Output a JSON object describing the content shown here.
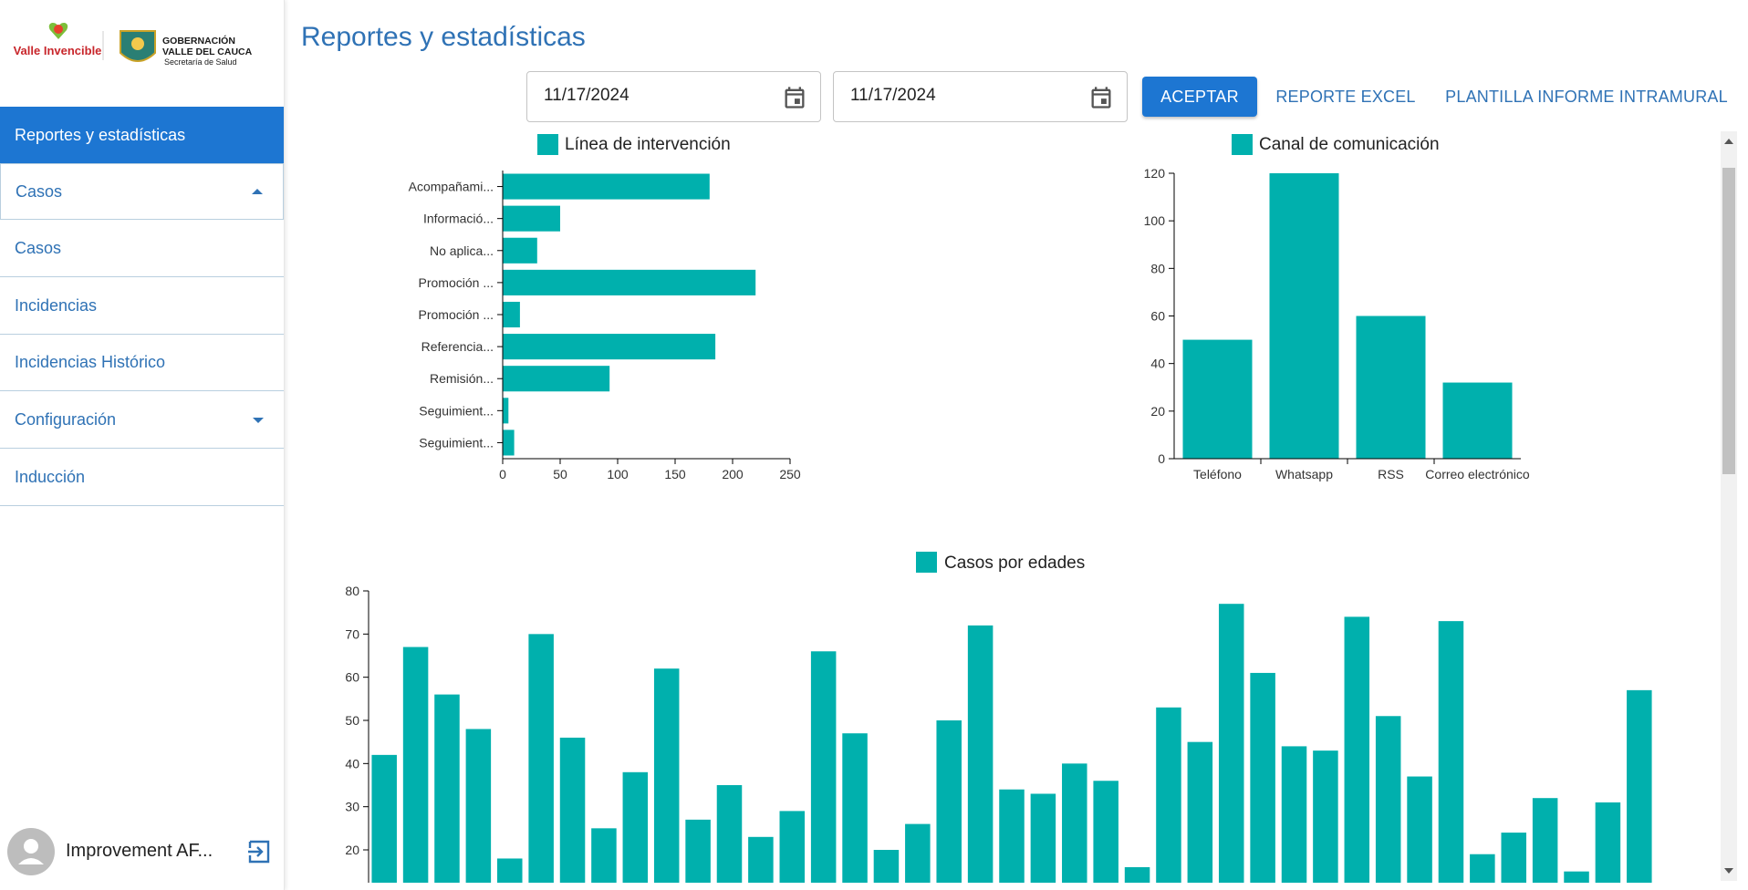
{
  "sidebar": {
    "logo_left": "Valle Invencible",
    "logo_right_line1": "GOBERNACIÓN",
    "logo_right_line2": "VALLE DEL CAUCA",
    "logo_right_line3": "Secretaría de Salud",
    "items": [
      {
        "label": "Reportes y estadísticas"
      },
      {
        "label": "Casos"
      },
      {
        "label": "Casos"
      },
      {
        "label": "Incidencias"
      },
      {
        "label": "Incidencias Histórico"
      },
      {
        "label": "Configuración"
      },
      {
        "label": "Inducción"
      }
    ],
    "user_name": "Improvement AF..."
  },
  "main": {
    "title": "Reportes y estadísticas",
    "date_from": "11/17/2024",
    "date_to": "11/17/2024",
    "accept_label": "ACEPTAR",
    "excel_label": "REPORTE EXCEL",
    "template_label": "PLANTILLA INFORME INTRAMURAL"
  },
  "colors": {
    "accent": "#1d76d2",
    "bar": "#00b0ad",
    "link": "#2f72b5"
  },
  "chart_data": [
    {
      "type": "bar",
      "orientation": "horizontal",
      "legend": "Línea de intervención",
      "categories": [
        "Acompañami...",
        "Informació...",
        "No aplica...",
        "Promoción ...",
        "Promoción ...",
        "Referencia...",
        "Remisión...",
        "Seguimient...",
        "Seguimient..."
      ],
      "values": [
        180,
        50,
        30,
        220,
        15,
        185,
        93,
        5,
        10
      ],
      "xlim": [
        0,
        250
      ],
      "xticks": [
        0,
        50,
        100,
        150,
        200,
        250
      ]
    },
    {
      "type": "bar",
      "legend": "Canal de comunicación",
      "categories": [
        "Teléfono",
        "Whatsapp",
        "RSS",
        "Correo electrónico"
      ],
      "values": [
        50,
        120,
        60,
        32
      ],
      "ylim": [
        0,
        120
      ],
      "yticks": [
        0,
        20,
        40,
        60,
        80,
        100,
        120
      ]
    },
    {
      "type": "bar",
      "legend": "Casos por edades",
      "values": [
        42,
        67,
        56,
        48,
        18,
        70,
        46,
        25,
        38,
        62,
        27,
        35,
        23,
        29,
        66,
        47,
        20,
        26,
        50,
        72,
        34,
        33,
        40,
        36,
        16,
        53,
        45,
        77,
        61,
        44,
        43,
        74,
        51,
        37,
        73,
        19,
        24,
        32,
        15,
        31,
        57
      ],
      "ylim": [
        0,
        80
      ],
      "yticks": [
        20,
        30,
        40,
        50,
        60,
        70,
        80
      ]
    }
  ]
}
